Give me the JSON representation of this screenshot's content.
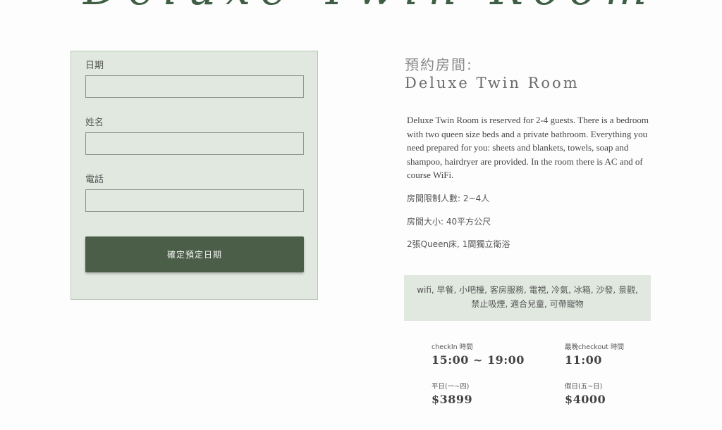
{
  "banner": {
    "title": "Deluxe Twin Room"
  },
  "form": {
    "date_label": "日期",
    "date_value": "",
    "name_label": "姓名",
    "name_value": "",
    "phone_label": "電話",
    "phone_value": "",
    "submit_label": "確定預定日期"
  },
  "room": {
    "booking_heading": "預約房間:",
    "name": "Deluxe Twin Room",
    "description": "Deluxe Twin Room is reserved for 2-4 guests. There is a bedroom with two queen size beds and a private bathroom. Everything you need prepared for you: sheets and blankets, towels, soap and shampoo, hairdryer are provided. In the room there is AC and of course WiFi.",
    "capacity": "房間限制人數:   2~4人",
    "size": "房間大小:   40平方公尺",
    "beds": "2張Queen床, 1間獨立衛浴",
    "amenities": "wifi, 早餐, 小吧檯, 客房服務, 電視, 冷氣, 冰箱, 沙發, 景觀, 禁止吸煙, 適合兒童, 可帶寵物"
  },
  "info": {
    "checkin_label": "checkIn 時間",
    "checkin_value": "15:00 ~ 19:00",
    "checkout_label": "最晚checkout 時間",
    "checkout_value": "11:00",
    "weekday_label": "平日(一~四)",
    "weekday_price": "$3899",
    "holiday_label": "假日(五~日)",
    "holiday_price": "$4000"
  },
  "colors": {
    "accent": "#4b5f48",
    "panel": "#e1e8e0",
    "banner": "#3f5f45"
  }
}
